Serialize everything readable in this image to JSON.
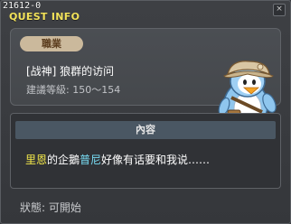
{
  "quest": {
    "id": "21612-0",
    "window_title": "QUEST INFO",
    "close_label": "×",
    "job_label": "職業",
    "name": "[战神] 狼群的访问",
    "recommended_level": "建議等級: 150～154",
    "content_header": "內容",
    "content": {
      "npc_1": "里恩",
      "text_1": "的企鵝",
      "npc_2": "普尼",
      "text_2": "好像有话要和我说……"
    },
    "status": "狀態: 可開始"
  }
}
